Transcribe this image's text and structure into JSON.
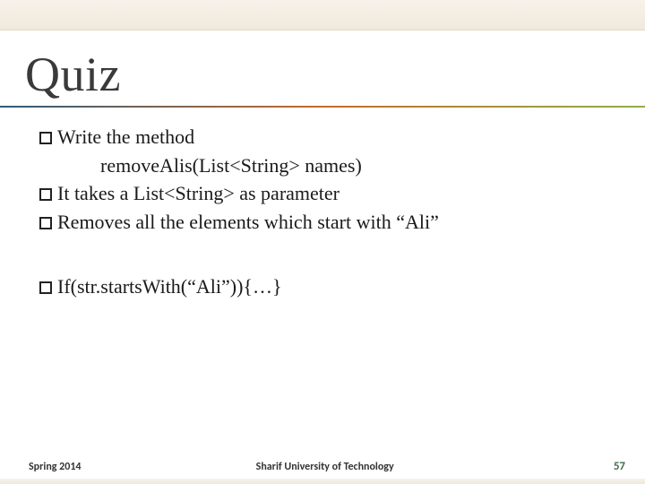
{
  "title": "Quiz",
  "lines": {
    "l1": "Write the method",
    "l2": "removeAlis(List<String> names)",
    "l3": "It takes a List<String> as parameter",
    "l4": "Removes all the elements which start with “Ali”",
    "l5": "If(str.startsWith(“Ali”)){…}"
  },
  "footer": {
    "left": "Spring 2014",
    "center": "Sharif University of Technology",
    "page": "57"
  }
}
